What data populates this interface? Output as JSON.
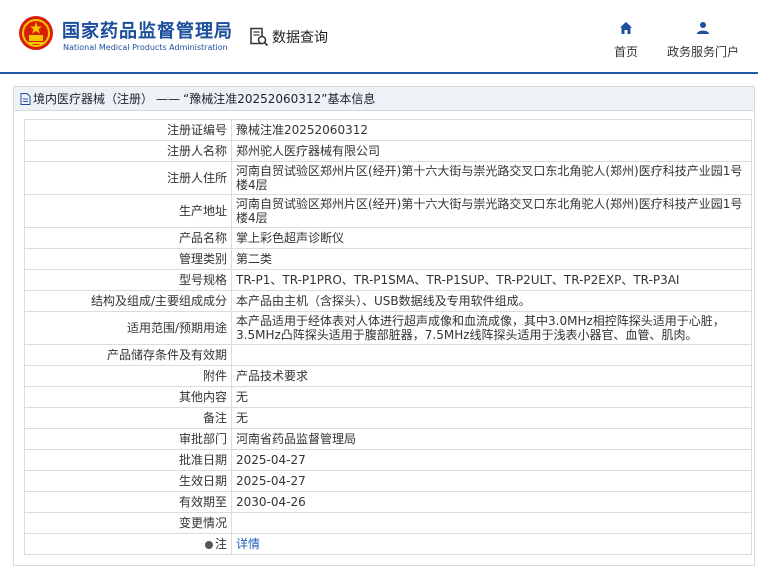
{
  "header": {
    "title_cn": "国家药品监督管理局",
    "title_en": "National Medical Products Administration",
    "query_label": "数据查询",
    "nav": [
      {
        "label": "首页",
        "icon": "home-icon"
      },
      {
        "label": "政务服务门户",
        "icon": "user-icon"
      }
    ],
    "colors": {
      "brand": "#1b4e9b",
      "divider": "#1f5ba8",
      "link": "#1d5fb8",
      "emblem": "#d81e06"
    }
  },
  "breadcrumb": {
    "category": "境内医疗器械（注册）",
    "separator": "——",
    "record": "“豫械注准20252060312”基本信息"
  },
  "details": {
    "rows": [
      {
        "label": "注册证编号",
        "value": "豫械注准20252060312"
      },
      {
        "label": "注册人名称",
        "value": "郑州驼人医疗器械有限公司"
      },
      {
        "label": "注册人住所",
        "value": "河南自贸试验区郑州片区(经开)第十六大街与崇光路交叉口东北角驼人(郑州)医疗科技产业园1号楼4层"
      },
      {
        "label": "生产地址",
        "value": "河南自贸试验区郑州片区(经开)第十六大街与崇光路交叉口东北角驼人(郑州)医疗科技产业园1号楼4层"
      },
      {
        "label": "产品名称",
        "value": "掌上彩色超声诊断仪"
      },
      {
        "label": "管理类别",
        "value": "第二类"
      },
      {
        "label": "型号规格",
        "value": "TR-P1、TR-P1PRO、TR-P1SMA、TR-P1SUP、TR-P2ULT、TR-P2EXP、TR-P3AI"
      },
      {
        "label": "结构及组成/主要组成成分",
        "value": "本产品由主机（含探头）、USB数据线及专用软件组成。"
      },
      {
        "label": "适用范围/预期用途",
        "value": "本产品适用于经体表对人体进行超声成像和血流成像，其中3.0MHz相控阵探头适用于心脏，3.5MHz凸阵探头适用于腹部脏器，7.5MHz线阵探头适用于浅表小器官、血管、肌肉。"
      },
      {
        "label": "产品储存条件及有效期",
        "value": ""
      },
      {
        "label": "附件",
        "value": "产品技术要求"
      },
      {
        "label": "其他内容",
        "value": "无"
      },
      {
        "label": "备注",
        "value": "无"
      },
      {
        "label": "审批部门",
        "value": "河南省药品监督管理局"
      },
      {
        "label": "批准日期",
        "value": "2025-04-27"
      },
      {
        "label": "生效日期",
        "value": "2025-04-27"
      },
      {
        "label": "有效期至",
        "value": "2030-04-26"
      },
      {
        "label": "变更情况",
        "value": ""
      }
    ],
    "note_row": {
      "label": "注",
      "link_text": "详情",
      "icon": "bullet-icon"
    }
  }
}
